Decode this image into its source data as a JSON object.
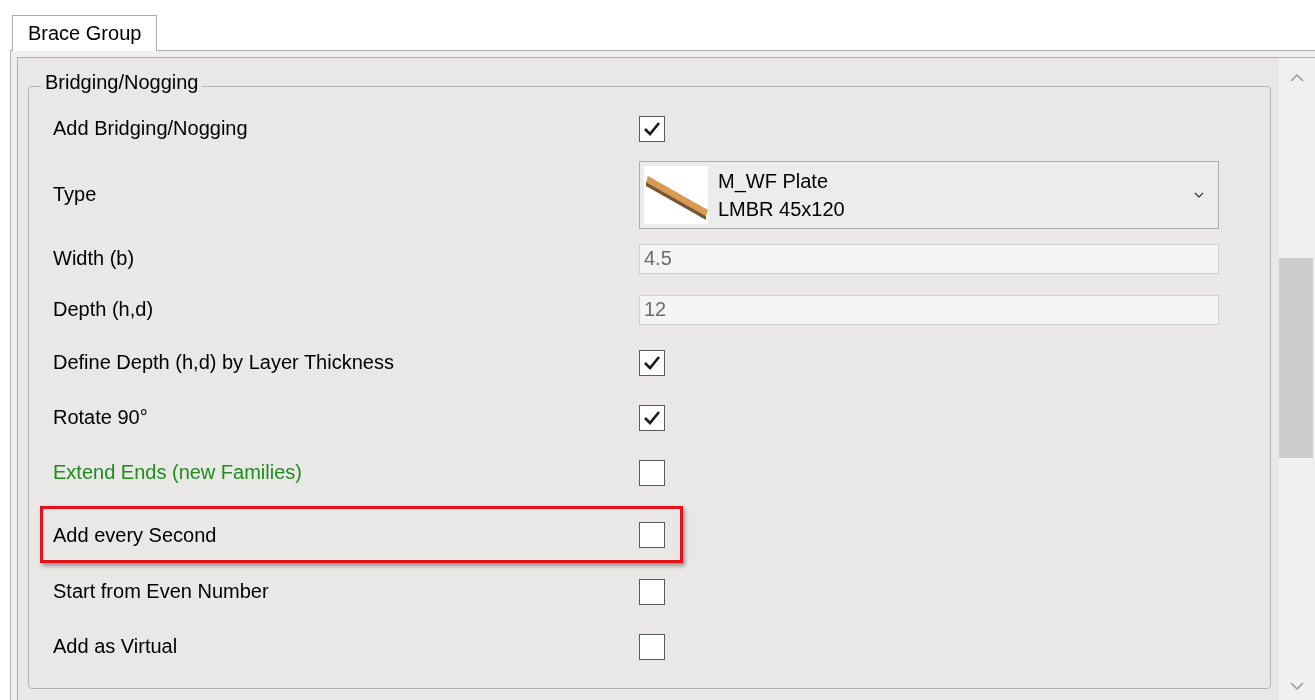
{
  "tabs": [
    {
      "label": "Brace Group",
      "selected": true
    }
  ],
  "group": {
    "title": "Bridging/Nogging"
  },
  "rows": [
    {
      "kind": "checkbox",
      "label": "Add Bridging/Nogging",
      "checked": true,
      "color": "#000000",
      "highlighted": false
    },
    {
      "kind": "combo",
      "label": "Type",
      "line_1": "M_WF Plate",
      "line_2": "LMBR 45x120",
      "color": "#000000",
      "highlighted": false
    },
    {
      "kind": "field",
      "label": "Width (b)",
      "value": "4.5",
      "disabled": true,
      "color": "#000000",
      "highlighted": false
    },
    {
      "kind": "field",
      "label": "Depth (h,d)",
      "value": "12",
      "disabled": true,
      "color": "#000000",
      "highlighted": false
    },
    {
      "kind": "checkbox",
      "label": "Define Depth (h,d) by Layer Thickness",
      "checked": true,
      "color": "#000000",
      "highlighted": false
    },
    {
      "kind": "checkbox",
      "label": "Rotate 90°",
      "checked": true,
      "color": "#000000",
      "highlighted": false
    },
    {
      "kind": "checkbox",
      "label": "Extend Ends (new Families)",
      "checked": false,
      "color": "#1e8c1e",
      "highlighted": false
    },
    {
      "kind": "checkbox",
      "label": "Add every Second",
      "checked": false,
      "color": "#000000",
      "highlighted": true
    },
    {
      "kind": "checkbox",
      "label": "Start from Even Number",
      "checked": false,
      "color": "#000000",
      "highlighted": false
    },
    {
      "kind": "checkbox",
      "label": "Add as Virtual",
      "checked": false,
      "color": "#000000",
      "highlighted": false
    }
  ]
}
